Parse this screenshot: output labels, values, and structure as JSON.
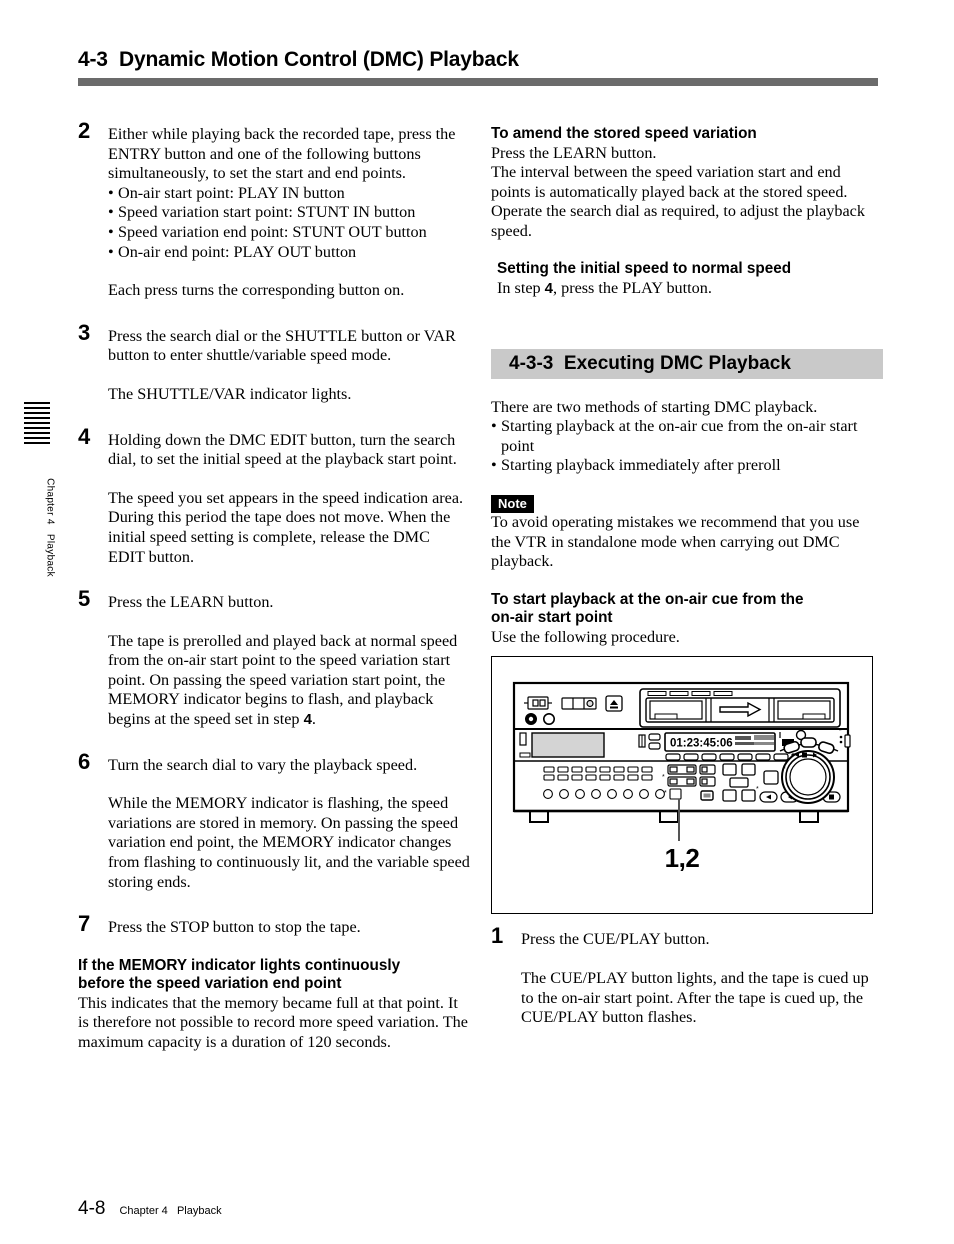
{
  "header": {
    "section_number": "4-3",
    "section_title": "Dynamic Motion Control (DMC) Playback",
    "title_full": "4-3  Dynamic Motion Control (DMC) Playback",
    "rule_color": "#6b6b6b"
  },
  "side_tab": {
    "label": "Chapter 4   Playback",
    "bar_count": 9
  },
  "left_column": {
    "step2": {
      "number": "2",
      "text": "Either while playing back the recorded tape, press the ENTRY button and one of the following buttons simultaneously, to set the start and end points.",
      "bullets": [
        "On-air start point: PLAY IN button",
        "Speed variation start point: STUNT IN button",
        "Speed variation end point: STUNT OUT button",
        "On-air end point: PLAY OUT button"
      ],
      "result": "Each press turns the corresponding button on."
    },
    "step3": {
      "number": "3",
      "text": "Press the search dial or the SHUTTLE button or VAR button to enter shuttle/variable speed mode.",
      "result": "The SHUTTLE/VAR indicator lights."
    },
    "step4": {
      "number": "4",
      "text": "Holding down the DMC EDIT button, turn the search dial, to set the initial speed at the playback start point.",
      "result": "The speed you set appears in the speed indication area. During this period the tape does not move. When the initial speed setting is complete, release the DMC EDIT button."
    },
    "step5": {
      "number": "5",
      "text": "Press the LEARN button.",
      "result_a": "The tape is prerolled and played back at normal speed from the on-air start point to the speed variation start point. On passing the speed variation start point, the MEMORY indicator begins to flash, and playback begins at the speed set in step ",
      "result_bold": "4",
      "result_b": "."
    },
    "step6": {
      "number": "6",
      "text": "Turn the search dial to vary the playback speed.",
      "result": "While the MEMORY indicator is flashing, the speed variations are stored in memory. On passing the speed variation end point, the MEMORY indicator changes from flashing to continuously lit, and the variable speed storing ends."
    },
    "step7": {
      "number": "7",
      "text": "Press the STOP button to stop the tape."
    },
    "memory_note": {
      "heading_line1": "If the MEMORY indicator lights continuously",
      "heading_line2": "before the speed variation end point",
      "body": "This indicates that the memory became full at that point. It is therefore not possible to record more speed variation. The maximum capacity is a duration of 120 seconds."
    }
  },
  "right_column": {
    "amend": {
      "heading": "To amend the stored speed variation",
      "line1": "Press the LEARN button.",
      "body": "The interval between the speed variation start and end points is automatically played back at the stored speed. Operate the search dial as required, to adjust the playback speed."
    },
    "initial_speed": {
      "heading": "Setting the initial speed to normal speed",
      "text_a": "In step ",
      "text_bold": "4",
      "text_b": ", press the PLAY button."
    },
    "subsection": {
      "number": "4-3-3",
      "title": "Executing DMC Playback",
      "title_full": "4-3-3  Executing DMC Playback",
      "bar_color": "#c9c9c9"
    },
    "intro": "There are two methods of starting DMC playback.",
    "methods": [
      "Starting playback at the on-air cue from the on-air start point",
      "Starting playback immediately after preroll"
    ],
    "note": {
      "badge": "Note",
      "body": "To avoid operating mistakes we recommend that you use the VTR in standalone mode when carrying out DMC playback."
    },
    "procedure": {
      "heading_line1": "To start playback at the on-air cue from the",
      "heading_line2": "on-air start point",
      "lead": "Use the following procedure."
    },
    "figure": {
      "callout": "1,2",
      "timecode": "01:23:45:06",
      "device": "vtr-front-panel-illustration"
    },
    "step1": {
      "number": "1",
      "text": "Press the CUE/PLAY button.",
      "result": "The CUE/PLAY button lights, and the tape is cued up to the on-air start point. After the tape is cued up, the CUE/PLAY button flashes."
    }
  },
  "footer": {
    "page_number": "4-8",
    "chapter": "Chapter 4   Playback"
  }
}
